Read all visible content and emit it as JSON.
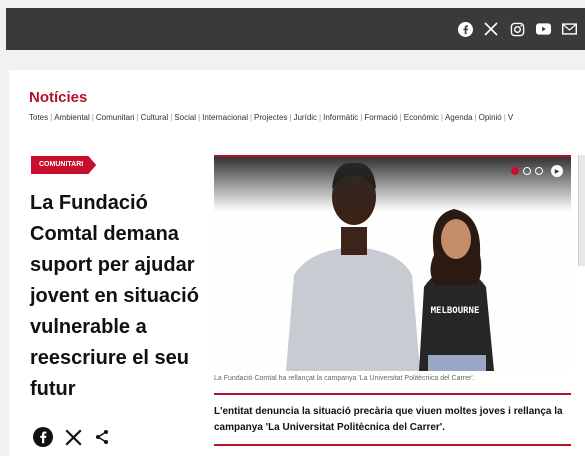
{
  "header": {
    "social_icons": [
      "facebook-icon",
      "x-icon",
      "instagram-icon",
      "youtube-icon",
      "mail-icon"
    ]
  },
  "section": {
    "title": "Notícies",
    "categories": [
      "Totes",
      "Ambiental",
      "Comunitari",
      "Cultural",
      "Social",
      "Internacional",
      "Projectes",
      "Jurídic",
      "Informàtic",
      "Formació",
      "Econòmic",
      "Agenda",
      "Opinió",
      "V"
    ]
  },
  "article": {
    "category_badge": "COMUNITARI",
    "headline": "La Fundació Comtal demana suport per ajudar jovent en situació vulnerable a reescriure el seu futur",
    "image_caption": "La Fundació Comtal ha rellançat la campanya 'La Universitat Politècnica del Carrer'.",
    "summary": "L'entitat denuncia la situació precària que viuen moltes joves i rellança la campanya 'La Universitat Politècnica del Carrer'.",
    "shirt_text": "MELBOURNE",
    "slider": {
      "current": 1,
      "total": 3
    }
  },
  "colors": {
    "accent": "#c8102e",
    "topbar": "#3a3a3a"
  }
}
